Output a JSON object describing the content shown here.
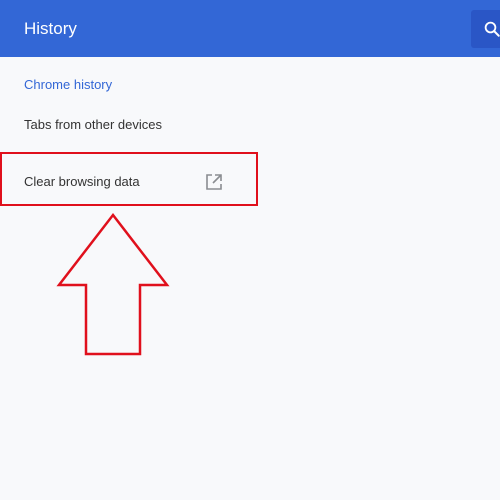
{
  "header": {
    "title": "History",
    "search_icon": "search-icon"
  },
  "sidebar": {
    "items": [
      {
        "label": "Chrome history",
        "selected": true
      },
      {
        "label": "Tabs from other devices",
        "selected": false
      },
      {
        "label": "Clear browsing data",
        "selected": false,
        "icon": "open-in-new-icon"
      }
    ]
  },
  "colors": {
    "header_bg": "#3367d6",
    "accent": "#3367d6",
    "annotation": "#e0101c"
  }
}
